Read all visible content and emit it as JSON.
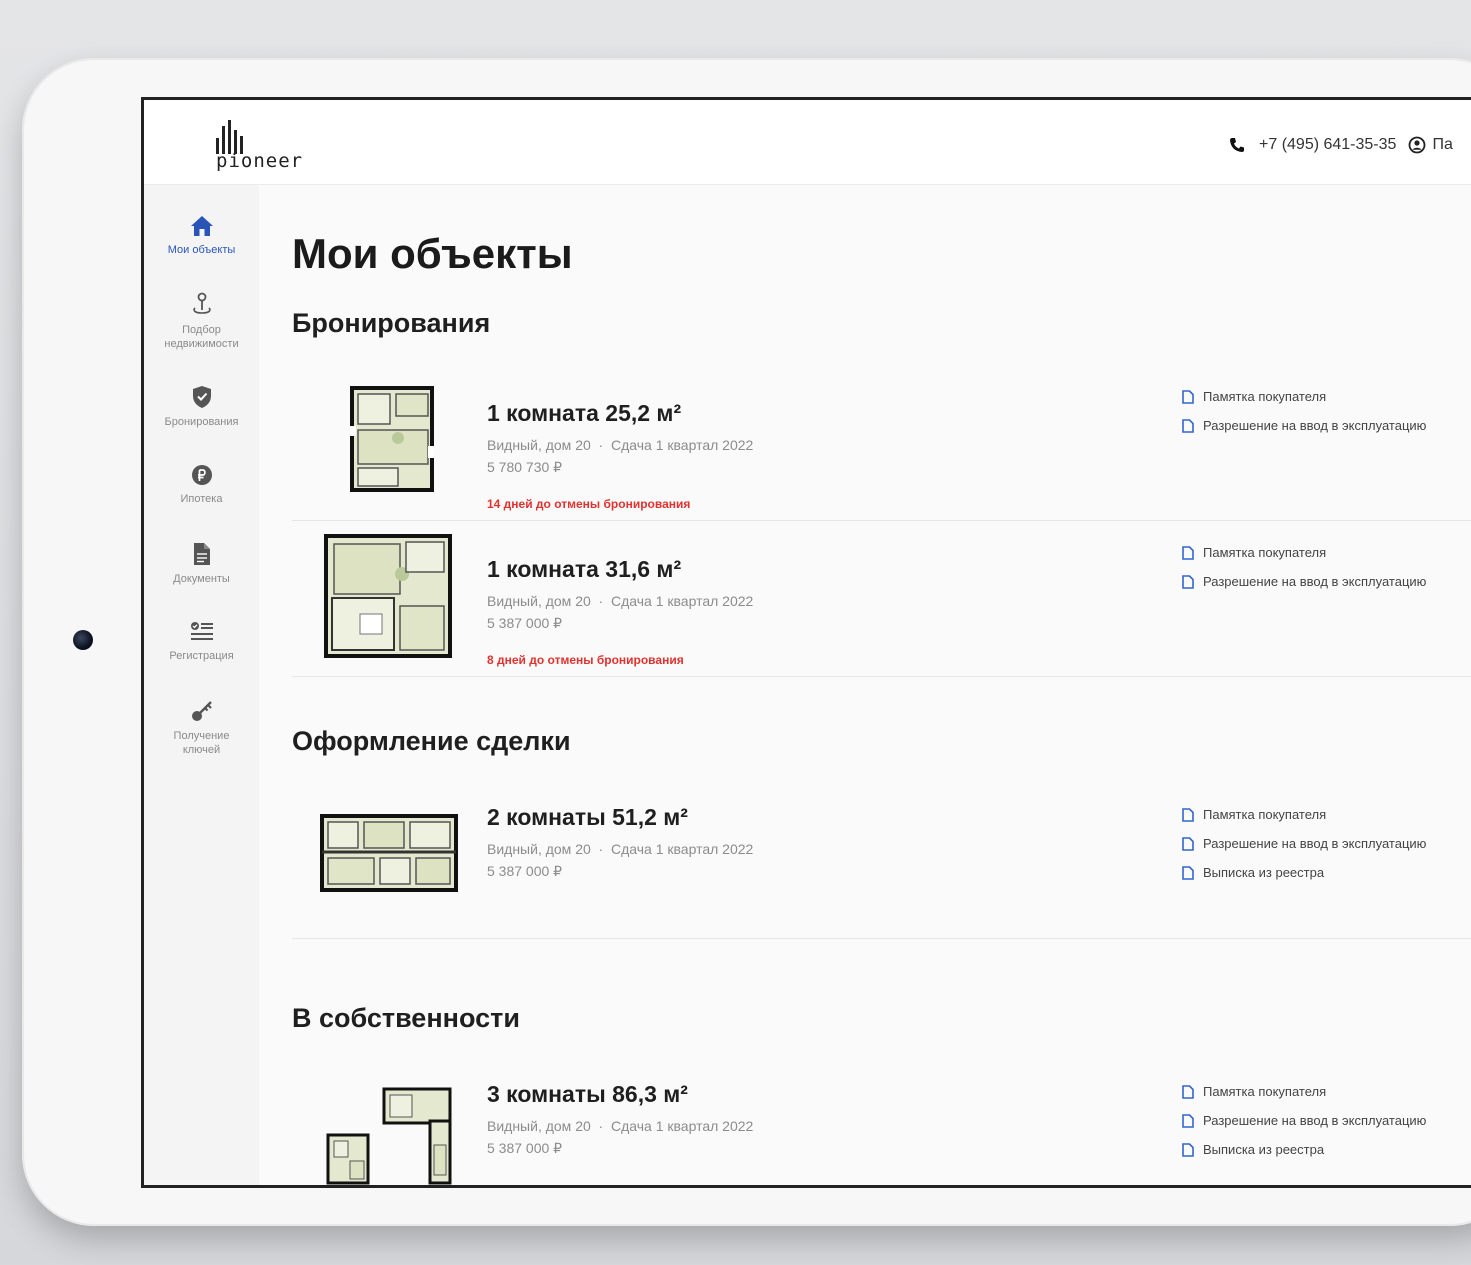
{
  "header": {
    "logo_text": "pioneer",
    "phone": "+7 (495) 641-35-35",
    "account_label": "Па"
  },
  "sidebar": {
    "items": [
      {
        "label": "Мои объекты",
        "icon": "home-icon",
        "active": true
      },
      {
        "label": "Подбор недвижимости",
        "icon": "location-pin-icon",
        "active": false
      },
      {
        "label": "Бронирования",
        "icon": "shield-check-icon",
        "active": false
      },
      {
        "label": "Ипотека",
        "icon": "ruble-coin-icon",
        "active": false
      },
      {
        "label": "Документы",
        "icon": "document-icon",
        "active": false
      },
      {
        "label": "Регистрация",
        "icon": "checklist-icon",
        "active": false
      },
      {
        "label": "Получение ключей",
        "icon": "key-icon",
        "active": false
      }
    ]
  },
  "main": {
    "title": "Мои объекты",
    "sections": [
      {
        "title": "Бронирования",
        "cards": [
          {
            "name": "1 комната 25,2 м²",
            "project": "Видный, дом 20",
            "delivery": "Сдача 1 квартал 2022",
            "price": "5 780 730 ₽",
            "warning": "14 дней до отмены бронирования",
            "docs": [
              "Памятка покупателя",
              "Разрешение на ввод в эксплуатацию"
            ]
          },
          {
            "name": "1 комната 31,6 м²",
            "project": "Видный, дом 20",
            "delivery": "Сдача 1 квартал 2022",
            "price": "5 387 000 ₽",
            "warning": "8 дней до отмены бронирования",
            "docs": [
              "Памятка покупателя",
              "Разрешение на ввод в эксплуатацию"
            ]
          }
        ]
      },
      {
        "title": "Оформление сделки",
        "cards": [
          {
            "name": "2 комнаты 51,2 м²",
            "project": "Видный, дом 20",
            "delivery": "Сдача 1 квартал 2022",
            "price": "5 387 000 ₽",
            "docs": [
              "Памятка покупателя",
              "Разрешение на ввод в эксплуатацию",
              "Выписка из реестра"
            ]
          }
        ]
      },
      {
        "title": "В собственности",
        "cards": [
          {
            "name": "3 комнаты 86,3 м²",
            "project": "Видный, дом 20",
            "delivery": "Сдача 1 квартал 2022",
            "price": "5 387 000 ₽",
            "docs": [
              "Памятка покупателя",
              "Разрешение на ввод в эксплуатацию",
              "Выписка из реестра"
            ]
          }
        ]
      }
    ]
  },
  "colors": {
    "accent": "#2a54b8",
    "warning": "#e0322f",
    "doc_icon": "#3366cc",
    "plan_fill": "#e3e8cf"
  }
}
